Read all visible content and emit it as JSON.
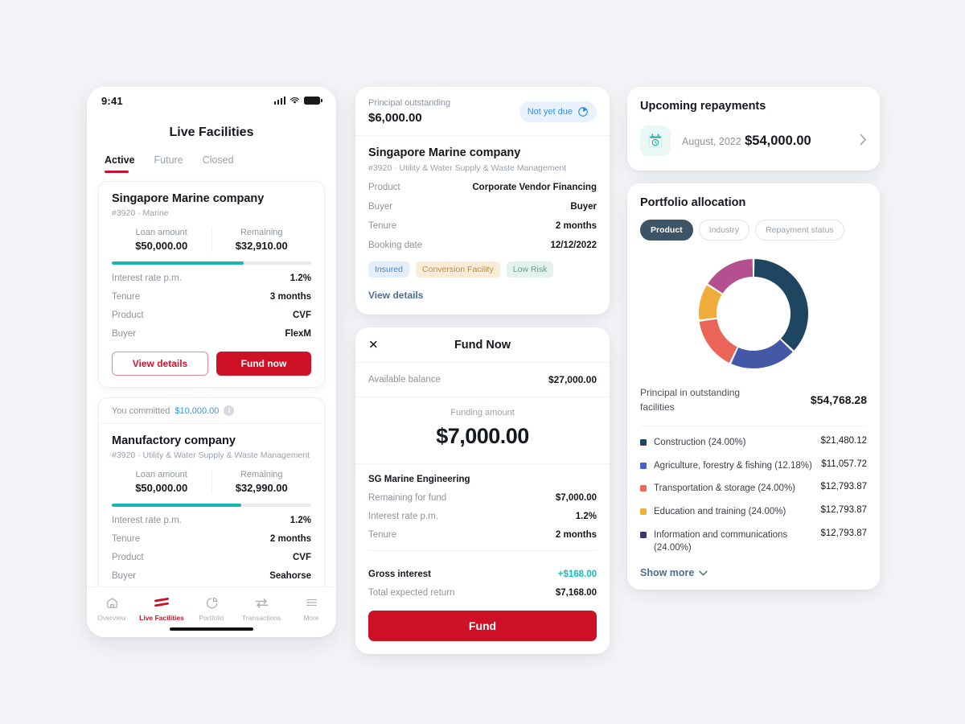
{
  "phone": {
    "status": {
      "time": "9:41",
      "signal_icon": "cellular-bars-icon",
      "wifi_icon": "wifi-icon",
      "battery_icon": "battery-icon"
    },
    "title": "Live Facilities",
    "tabs": [
      {
        "label": "Active",
        "active": true
      },
      {
        "label": "Future",
        "active": false
      },
      {
        "label": "Closed",
        "active": false
      }
    ],
    "facilities": [
      {
        "committed": null,
        "name": "Singapore Marine company",
        "sub": "#3920  ·  Marine",
        "loan_label": "Loan amount",
        "loan_value": "$50,000.00",
        "remaining_label": "Remaining",
        "remaining_value": "$32,910.00",
        "progress_pct": 66,
        "rows": [
          {
            "k": "Interest rate p.m.",
            "v": "1.2%"
          },
          {
            "k": "Tenure",
            "v": "3 months"
          },
          {
            "k": "Product",
            "v": "CVF"
          },
          {
            "k": "Buyer",
            "v": "FlexM"
          }
        ],
        "btn_outline": "View details",
        "btn_solid": "Fund now"
      },
      {
        "committed_prefix": "You committed",
        "committed_amount": "$10,000.00",
        "name": "Manufactory company",
        "sub": "#3920  ·  Utility & Water Supply & Waste Management",
        "loan_label": "Loan amount",
        "loan_value": "$50,000.00",
        "remaining_label": "Remaining",
        "remaining_value": "$32,990.00",
        "progress_pct": 65,
        "rows": [
          {
            "k": "Interest rate p.m.",
            "v": "1.2%"
          },
          {
            "k": "Tenure",
            "v": "2 months"
          },
          {
            "k": "Product",
            "v": "CVF"
          },
          {
            "k": "Buyer",
            "v": "Seahorse"
          }
        ]
      }
    ],
    "tabbar": [
      {
        "label": "Overview",
        "icon": "home-icon",
        "active": false
      },
      {
        "label": "Live Facilities",
        "icon": "stacked-bars-icon",
        "active": true
      },
      {
        "label": "Portfolio",
        "icon": "pie-chart-icon",
        "active": false
      },
      {
        "label": "Transactions",
        "icon": "transfer-arrows-icon",
        "active": false
      },
      {
        "label": "More",
        "icon": "menu-lines-icon",
        "active": false
      }
    ]
  },
  "detail": {
    "principal_label": "Principal outstanding",
    "principal_value": "$6,000.00",
    "status_pill": "Not yet due",
    "status_icon": "pie-timer-icon",
    "name": "Singapore Marine company",
    "sub": "#3920  ·  Utility & Water Supply & Waste Management",
    "rows": [
      {
        "k": "Product",
        "v": "Corporate Vendor Financing"
      },
      {
        "k": "Buyer",
        "v": "Buyer"
      },
      {
        "k": "Tenure",
        "v": "2 months"
      },
      {
        "k": "Booking date",
        "v": "12/12/2022"
      }
    ],
    "chips": [
      {
        "label": "Insured",
        "bg": "#e3eefb",
        "fg": "#4b86c9"
      },
      {
        "label": "Conversion Facility",
        "bg": "#fbecd7",
        "fg": "#b98b4e"
      },
      {
        "label": "Low Risk",
        "bg": "#e3f2ec",
        "fg": "#6c9d8a"
      }
    ],
    "view_details": "View details"
  },
  "fund": {
    "close_icon": "close-icon",
    "title": "Fund Now",
    "balance_label": "Available balance",
    "balance_value": "$27,000.00",
    "amount_label": "Funding amount",
    "amount_value": "$7,000.00",
    "company": "SG Marine Engineering",
    "rows": [
      {
        "k": "Remaining for fund",
        "v": "$7,000.00"
      },
      {
        "k": "Interest rate p.m.",
        "v": "1.2%"
      },
      {
        "k": "Tenure",
        "v": "2 months"
      }
    ],
    "gross_label": "Gross interest",
    "gross_value": "+$168.00",
    "total_label": "Total expected return",
    "total_value": "$7,168.00",
    "cta": "Fund"
  },
  "repayments": {
    "title": "Upcoming repayments",
    "icon": "calendar-clock-icon",
    "date": "August, 2022",
    "amount": "$54,000.00",
    "chevron": "chevron-right-icon"
  },
  "portfolio": {
    "title": "Portfolio allocation",
    "segments": [
      {
        "label": "Product",
        "active": true
      },
      {
        "label": "Industry",
        "active": false
      },
      {
        "label": "Repayment status",
        "active": false
      }
    ],
    "total_label": "Principal in outstanding facilities",
    "total_value": "$54,768.28",
    "show_more": "Show more",
    "show_more_icon": "chevron-down-icon",
    "accent": "#3d5366",
    "brand_red": "#ce1126",
    "teal": "#14b8b0"
  },
  "chart_data": {
    "type": "pie",
    "title": "Portfolio allocation",
    "subtype": "donut",
    "legend_position": "below",
    "categories": [
      "Construction (24.00%)",
      "Agriculture, forestry & fishing (12.18%)",
      "Transportation & storage (24.00%)",
      "Education and training (24.00%)",
      "Information and communications (24.00%)"
    ],
    "labels": [
      "Construction",
      "Agriculture, forestry & fishing",
      "Transportation & storage",
      "Education and training",
      "Information and communications"
    ],
    "percentages": [
      37.0,
      20.0,
      16.0,
      11.0,
      16.0
    ],
    "stated_percentages": [
      "24.00%",
      "12.18%",
      "24.00%",
      "24.00%",
      "24.00%"
    ],
    "values": [
      21480.12,
      11057.72,
      12793.87,
      12793.87,
      12793.87
    ],
    "value_labels": [
      "$21,480.12",
      "$11,057.72",
      "$12,793.87",
      "$12,793.87",
      "$12,793.87"
    ],
    "colors": [
      "#1f4661",
      "#4458a8",
      "#ea6458",
      "#f0ad3c",
      "#b4508f"
    ],
    "legend_colors": [
      "#1f4661",
      "#3f63c9",
      "#ee6a5e",
      "#f0ad3c",
      "#3b3572"
    ],
    "total": 54768.28,
    "total_label": "Principal in outstanding facilities"
  }
}
